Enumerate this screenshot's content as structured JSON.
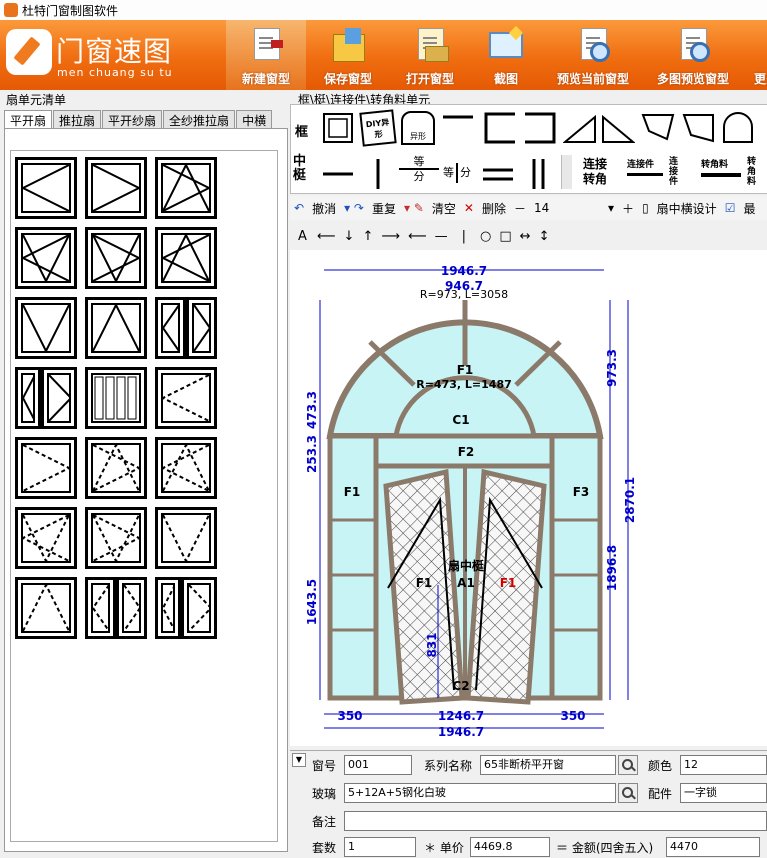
{
  "window": {
    "title": "杜特门窗制图软件"
  },
  "logo": {
    "cn": "门窗速图",
    "pinyin": "men chuang su tu"
  },
  "toolbar": [
    {
      "label": "新建窗型",
      "icon": "new-document-icon"
    },
    {
      "label": "保存窗型",
      "icon": "save-icon"
    },
    {
      "label": "打开窗型",
      "icon": "open-icon"
    },
    {
      "label": "截图",
      "icon": "screenshot-icon"
    },
    {
      "label": "预览当前窗型",
      "icon": "preview-icon"
    },
    {
      "label": "多图预览窗型",
      "icon": "multi-preview-icon"
    },
    {
      "label": "更多",
      "icon": "more-icon"
    }
  ],
  "left_panel": {
    "title": "扇单元清单",
    "tabs": [
      "平开扇",
      "推拉扇",
      "平开纱扇",
      "全纱推拉扇",
      "中横"
    ],
    "selected_tab": "平开扇"
  },
  "right_panel": {
    "title": "框\\梃\\连接件\\转角料单元",
    "row1_label": "框",
    "row2_label": "中梃",
    "diy_label": "DIY异形",
    "yixing_label": "异形",
    "items": {
      "eq_top": "等",
      "eq_bottom": "分",
      "eq_side": "等",
      "eq_side2": "分",
      "lianjie": "连接",
      "zhuanjiao": "转角",
      "ljj": "连接件",
      "ljj_v": "连接件",
      "zjl": "转角料",
      "zjl_v": "转角料"
    }
  },
  "edit_toolbar": {
    "undo": "撤消",
    "redo": "重复",
    "clear": "清空",
    "delete": "删除",
    "minus": "－",
    "size": "14",
    "plus": "＋",
    "sash_mullion": "扇中横设计",
    "more": "最"
  },
  "draw_toolbar": {
    "text": "A"
  },
  "drawing": {
    "dim_top": "1946.7",
    "dim_arc": "946.7",
    "arc_outer": "R=973, L=3058",
    "arc_inner": "R=473, L=1487",
    "label_f1_top": "F1",
    "label_c1": "C1",
    "label_f2": "F2",
    "label_f1_left": "F1",
    "label_f3": "F3",
    "label_mid": "扇中梃",
    "label_f1_center": "F1",
    "label_a1": "A1",
    "label_f1_red": "F1",
    "label_c2": "C2",
    "dim_left_473": "473.3",
    "dim_left_253": "253.3",
    "dim_left_1643": "1643.5",
    "dim_right_973": "973.3",
    "dim_right_1896": "1896.8",
    "dim_right_2870": "2870.1",
    "dim_831": "831",
    "dim_b_350l": "350",
    "dim_b_1246": "1246.7",
    "dim_b_350r": "350",
    "dim_bottom": "1946.7"
  },
  "form": {
    "no_label": "窗号",
    "no_value": "001",
    "series_label": "系列名称",
    "series_value": "65非断桥平开窗",
    "color_label": "颜色",
    "color_value": "12",
    "glass_label": "玻璃",
    "glass_value": "5+12A+5钢化白玻",
    "fittings_label": "配件",
    "fittings_value": "一字锁",
    "remark_label": "备注",
    "remark_value": "",
    "qty_label": "套数",
    "qty_value": "1",
    "price_label": "＊ 单价",
    "price_value": "4469.8",
    "amount_label": "＝ 金额(四舍五入)",
    "amount_value": "4470"
  },
  "colors": {
    "banner": "#f06d10",
    "glass": "#c8f4f6",
    "frame": "#8b7a6a",
    "dim": "#0000cc"
  }
}
